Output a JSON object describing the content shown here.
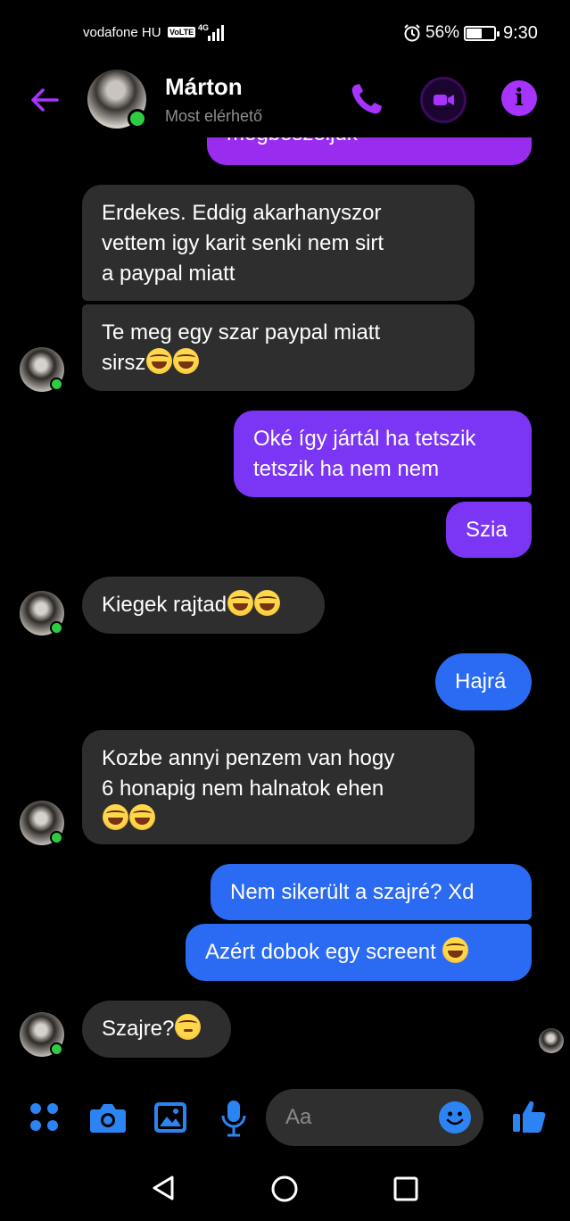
{
  "status_bar": {
    "carrier": "vodafone HU",
    "volte": "VoLTE",
    "network": "4G",
    "battery_percent": "56%",
    "battery_level": 0.56,
    "time": "9:30"
  },
  "header": {
    "contact_name": "Márton",
    "contact_status": "Most elérhető"
  },
  "messages": {
    "m0_cut": "megbeszéljük",
    "m1": "Erdekes. Eddig akarhanyszor",
    "m1b": "vettem igy karit senki nem sirt",
    "m1c": "a paypal miatt",
    "m2": "Te meg egy szar paypal miatt",
    "m2b": "sirsz",
    "m3": "Oké így jártál ha tetszik",
    "m3b": "tetszik ha nem nem",
    "m4": "Szia",
    "m5": "Kiegek rajtad",
    "m6": "Hajrá",
    "m7": "Kozbe annyi penzem van hogy",
    "m7b": "6 honapig nem halnatok ehen",
    "m8": "Nem sikerült a szajré? Xd",
    "m9": "Azért dobok egy screent",
    "m10": "Szajre?"
  },
  "composer": {
    "placeholder": "Aa"
  },
  "colors": {
    "accent_purple": "#a733ff",
    "bubble_incoming": "#2e2e2e",
    "bubble_purple": "#7a35f5",
    "bubble_blue": "#2b6bf3",
    "composer_blue": "#2c84f2",
    "online_green": "#2ecc40"
  }
}
